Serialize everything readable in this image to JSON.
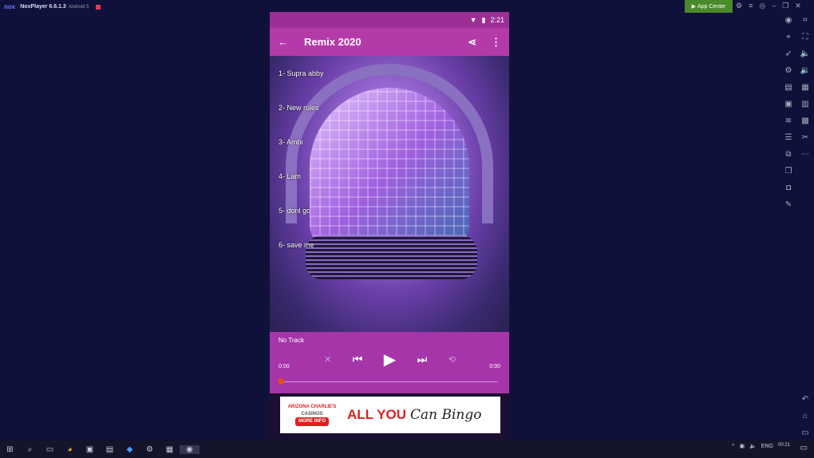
{
  "window": {
    "logo": "nox",
    "title": "NoxPlayer 6.6.1.3",
    "android": "Android 5",
    "app_center": "App Center"
  },
  "status": {
    "time": "2:21"
  },
  "toolbar": {
    "title": "Remix 2020"
  },
  "tracks": [
    "1- Supra abby",
    "2- New rules",
    "3- Ambi",
    "4- Lam",
    "5- donl go",
    "6- save me"
  ],
  "player": {
    "track": "No Track",
    "elapsed": "0:00",
    "duration": "0:00",
    "progress": 0
  },
  "ad": {
    "brand": "ARIZONA CHARLIE'S",
    "brand_sub": "CASINOS",
    "more": "MORE INFO",
    "headline": "ALL YOU",
    "script": "Can Bingo"
  },
  "tray": {
    "lang": "ENG",
    "time": "00:21"
  }
}
